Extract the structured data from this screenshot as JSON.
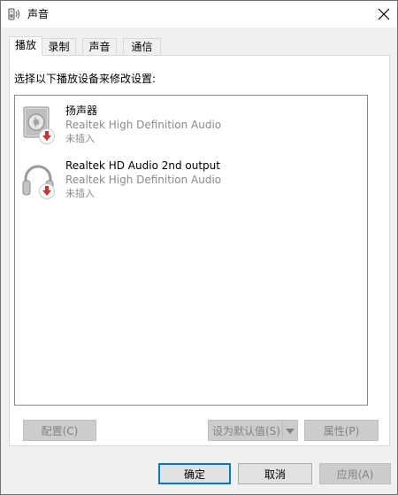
{
  "window": {
    "title": "声音",
    "icon": "speaker-icon"
  },
  "tabs": [
    {
      "label": "播放",
      "active": true
    },
    {
      "label": "录制",
      "active": false
    },
    {
      "label": "声音",
      "active": false
    },
    {
      "label": "通信",
      "active": false
    }
  ],
  "playback": {
    "instruction": "选择以下播放设备来修改设置:",
    "devices": [
      {
        "name": "扬声器",
        "description": "Realtek High Definition Audio",
        "status": "未插入",
        "icon": "speaker-device-icon",
        "badge": "unplugged-arrow-icon"
      },
      {
        "name": "Realtek HD Audio 2nd output",
        "description": "Realtek High Definition Audio",
        "status": "未插入",
        "icon": "headphones-device-icon",
        "badge": "unplugged-arrow-icon"
      }
    ]
  },
  "panel_buttons": {
    "configure": "配置(C)",
    "set_default": "设为默认值(S)",
    "properties": "属性(P)"
  },
  "dialog_buttons": {
    "ok": "确定",
    "cancel": "取消",
    "apply": "应用(A)"
  },
  "colors": {
    "accent": "#0078d7",
    "unplugged_badge": "#d32f2f",
    "disabled_text": "#838383"
  }
}
